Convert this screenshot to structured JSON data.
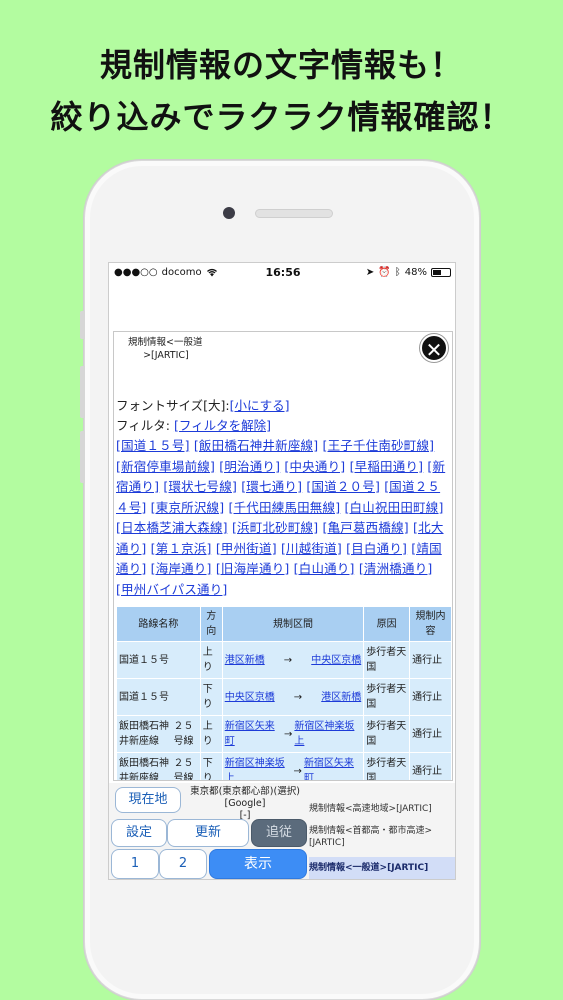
{
  "headline": {
    "line1": "規制情報の文字情報も！",
    "line2": "絞り込みでラクラク情報確認！"
  },
  "status_bar": {
    "carrier": "docomo",
    "time": "16:56",
    "battery": "48%",
    "signal_dots": "●●●○○"
  },
  "panel": {
    "title": "規制情報<一般道\n     >[JARTIC]",
    "close_symbol": "✕",
    "font_size_label": "フォントサイズ[大]:",
    "font_size_link": "[小にする]",
    "filter_label": "フィルタ:",
    "filter_clear_link": "[フィルタを解除]",
    "filter_links": [
      "[国道１５号]",
      "[飯田橋石神井新座線]",
      "[王子千住南砂町線]",
      "[新宿停車場前線]",
      "[明治通り]",
      "[中央通り]",
      "[早稲田通り]",
      "[新宿通り]",
      "[環状七号線]",
      "[環七通り]",
      "[国道２０号]",
      "[国道２５４号]",
      "[東京所沢線]",
      "[千代田練馬田無線]",
      "[白山祝田田町線]",
      "[日本橋芝浦大森線]",
      "[浜町北砂町線]",
      "[亀戸葛西橋線]",
      "[北大通り]",
      "[第１京浜]",
      "[甲州街道]",
      "[川越街道]",
      "[目白通り]",
      "[靖国通り]",
      "[海岸通り]",
      "[旧海岸通り]",
      "[白山通り]",
      "[清洲橋通り]",
      "[甲州バイパス通り]"
    ],
    "table": {
      "headers": [
        "路線名称",
        "方向",
        "規制区間",
        "原因",
        "規制内容"
      ],
      "rows": [
        {
          "road": "国道１５号",
          "road_suffix": "",
          "dir": "上り",
          "from": "港区新橋",
          "arrow": "→",
          "to": "中央区京橋",
          "cause": "歩行者天国",
          "content": "通行止"
        },
        {
          "road": "国道１５号",
          "road_suffix": "",
          "dir": "下り",
          "from": "中央区京橋",
          "arrow": "→",
          "to": "港区新橋",
          "cause": "歩行者天国",
          "content": "通行止"
        },
        {
          "road": "飯田橋石神井新座線",
          "road_suffix": "２５号線",
          "dir": "上り",
          "from": "新宿区矢来町",
          "arrow": "→",
          "to": "新宿区神楽坂上",
          "cause": "歩行者天国",
          "content": "通行止"
        },
        {
          "road": "飯田橋石神井新座線",
          "road_suffix": "２５号線",
          "dir": "下り",
          "from": "新宿区神楽坂上",
          "arrow": "→",
          "to": "新宿区矢来町",
          "cause": "歩行者天国",
          "content": "通行止"
        }
      ]
    }
  },
  "bottom_bar": {
    "current_location_button": "現在地",
    "location_text": "東京都(東京都心部)(選択)[Google]",
    "location_sub": "[-]",
    "settings_button": "設定",
    "update_button": "更新",
    "follow_button": "追従",
    "page1_button": "1",
    "page2_button": "2",
    "show_button": "表示",
    "layer_links": [
      "規制情報<高速地域>[JARTIC]",
      "規制情報<首都高・都市高速>[JARTIC]",
      "規制情報<一般道>[JARTIC]"
    ]
  }
}
